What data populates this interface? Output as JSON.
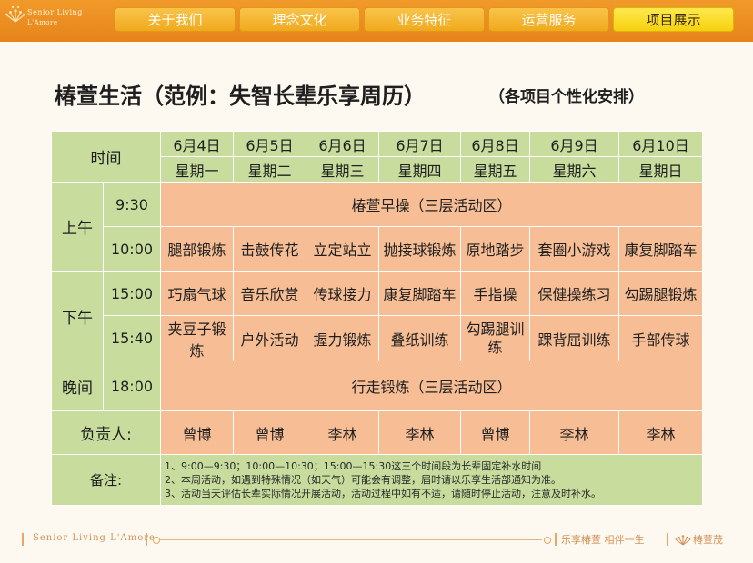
{
  "brand": {
    "line1": "Senior Living",
    "line2": "L'Amore"
  },
  "nav": {
    "tabs": [
      {
        "label": "关于我们"
      },
      {
        "label": "理念文化"
      },
      {
        "label": "业务特征"
      },
      {
        "label": "运营服务"
      },
      {
        "label": "项目展示",
        "active": true
      }
    ]
  },
  "page": {
    "title": "椿萱生活（范例：失智长辈乐享周历）",
    "subtitle": "（各项目个性化安排）"
  },
  "table": {
    "time_header": "时间",
    "dates": [
      "6月4日",
      "6月5日",
      "6月6日",
      "6月7日",
      "6月8日",
      "6月9日",
      "6月10日"
    ],
    "weekdays": [
      "星期一",
      "星期二",
      "星期三",
      "星期四",
      "星期五",
      "星期六",
      "星期日"
    ],
    "periods": {
      "morning": "上午",
      "afternoon": "下午",
      "evening": "晚间"
    },
    "rows": {
      "r930": {
        "time": "9:30",
        "activity": "椿萱早操（三层活动区）"
      },
      "r1000": {
        "time": "10:00",
        "cells": [
          "腿部锻炼",
          "击鼓传花",
          "立定站立",
          "抛接球锻炼",
          "原地踏步",
          "套圈小游戏",
          "康复脚踏车"
        ]
      },
      "r1500": {
        "time": "15:00",
        "cells": [
          "巧扇气球",
          "音乐欣赏",
          "传球接力",
          "康复脚踏车",
          "手指操",
          "保健操练习",
          "勾踢腿锻炼"
        ]
      },
      "r1540": {
        "time": "15:40",
        "cells": [
          "夹豆子锻炼",
          "户外活动",
          "握力锻炼",
          "叠纸训练",
          "勾踢腿训练",
          "踝背屈训练",
          "手部传球"
        ]
      },
      "r1800": {
        "time": "18:00",
        "activity": "行走锻炼（三层活动区）"
      }
    },
    "owner": {
      "label": "负责人:",
      "names": [
        "曾博",
        "曾博",
        "李林",
        "李林",
        "曾博",
        "李林",
        "李林"
      ]
    },
    "notes": {
      "label": "备注:",
      "lines": [
        "1、9:00—9:30；10:00—10:30；15:00—15:30这三个时间段为长辈固定补水时间",
        "2、本周活动，如遇到特殊情况（如天气）可能会有调整，届时请以乐享生活部通知为准。",
        "3、活动当天评估长辈实际情况开展活动，活动过程中如有不适，请随时停止活动，注意及时补水。"
      ]
    }
  },
  "footer": {
    "brand": "Senior Living L'Amore",
    "slogan": "乐享椿萱  相伴一生",
    "logo_text": "椿萱茂"
  },
  "colors": {
    "nav_bar": "#e6841b",
    "tab": "#f0a91d",
    "tab_active": "#f6d10e",
    "header_green": "#c7dc9d",
    "cell_orange": "#f7be95",
    "footer_accent": "#d49255"
  }
}
